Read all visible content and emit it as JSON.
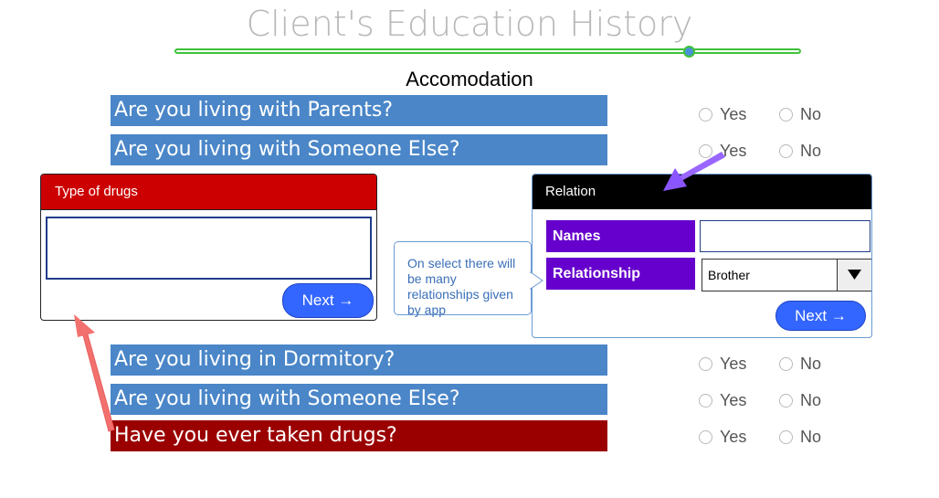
{
  "page": {
    "title": "Client's Education History",
    "section": "Accomodation",
    "progress": 0.82
  },
  "questions": [
    {
      "label": "Are you living with Parents?",
      "yes": "Yes",
      "no": "No",
      "color": "#4a86c8"
    },
    {
      "label": "Are you living with Someone Else?",
      "yes": "Yes",
      "no": "No",
      "color": "#4a86c8"
    },
    {
      "label": "Are you living in Dormitory?",
      "yes": "Yes",
      "no": "No",
      "color": "#4a86c8"
    },
    {
      "label": "Are you living with Someone Else?",
      "yes": "Yes",
      "no": "No",
      "color": "#4a86c8"
    },
    {
      "label": "Have you ever taken drugs?",
      "yes": "Yes",
      "no": "No",
      "color": "#9b0000"
    }
  ],
  "drugs_panel": {
    "title": "Type of drugs",
    "input_value": "",
    "next_label": "Next →",
    "header_color": "#cc0000"
  },
  "relation_panel": {
    "title": "Relation",
    "names_label": "Names",
    "names_value": "",
    "relationship_label": "Relationship",
    "relationship_value": "Brother",
    "next_label": "Next →",
    "label_color": "#6600cc"
  },
  "callout": {
    "text": "On select there will be many relationships given by app"
  },
  "colors": {
    "accent_blue": "#3366ff",
    "slider_green": "#3fc23a"
  }
}
